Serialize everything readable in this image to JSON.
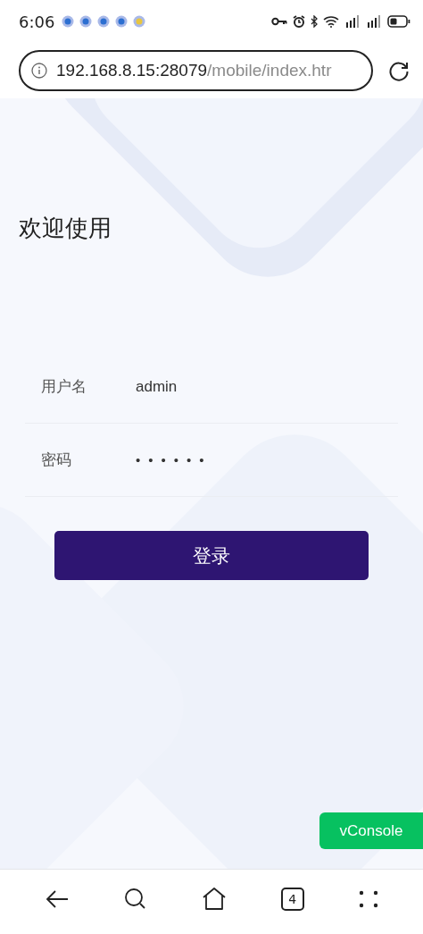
{
  "status_bar": {
    "time": "6:06"
  },
  "address_bar": {
    "host": "192.168.8.15:28079",
    "path": "/mobile/index.htr"
  },
  "page": {
    "title": "欢迎使用",
    "fields": [
      {
        "label": "用户名",
        "value": "admin",
        "kind": "text"
      },
      {
        "label": "密码",
        "value": "••••••",
        "kind": "password"
      }
    ],
    "login_button": "登录"
  },
  "vconsole_button": "vConsole",
  "bottom_nav": {
    "tab_count": "4"
  }
}
